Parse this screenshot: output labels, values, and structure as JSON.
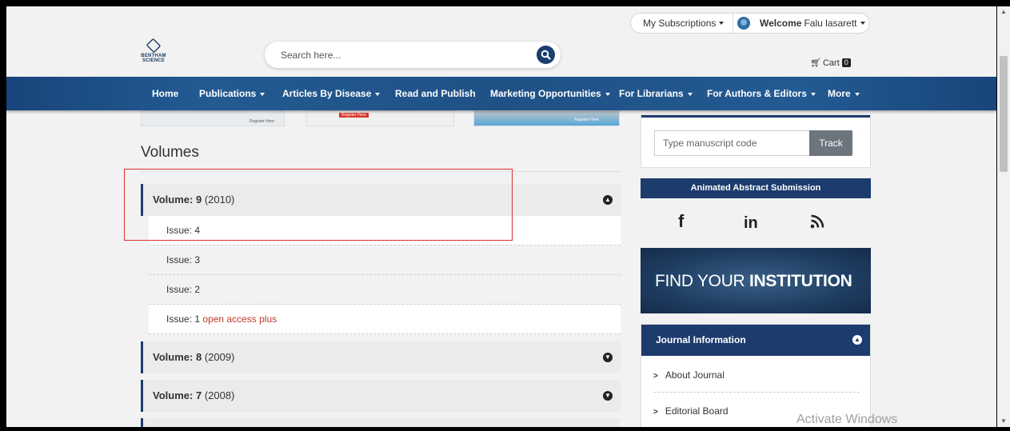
{
  "header": {
    "subscriptions_label": "My Subscriptions",
    "welcome_label": "Welcome",
    "user_name": "Falu lasarett",
    "logo_text_line1": "BENTHAM",
    "logo_text_line2": "SCIENCE",
    "search_placeholder": "Search here...",
    "cart_label": "Cart",
    "cart_count": "0"
  },
  "nav": {
    "items": [
      {
        "label": "Home",
        "dropdown": false
      },
      {
        "label": "Publications",
        "dropdown": true
      },
      {
        "label": "Articles By Disease",
        "dropdown": true
      },
      {
        "label": "Read and Publish",
        "dropdown": false
      },
      {
        "label": "Marketing Opportunities",
        "dropdown": true
      },
      {
        "label": "For Librarians",
        "dropdown": true
      },
      {
        "label": "For Authors & Editors",
        "dropdown": true
      },
      {
        "label": "More",
        "dropdown": true
      }
    ]
  },
  "banners": {
    "banner1_text": "Register Here",
    "banner2_text": "Register Here",
    "banner3_text": "Register Here"
  },
  "main": {
    "title": "Volumes",
    "volumes": [
      {
        "label": "Volume:",
        "number": "9",
        "year": "(2010)",
        "expanded": true,
        "issues": [
          {
            "label": "Issue:",
            "number": "4",
            "badge": ""
          },
          {
            "label": "Issue:",
            "number": "3",
            "badge": ""
          },
          {
            "label": "Issue:",
            "number": "2",
            "badge": ""
          },
          {
            "label": "Issue:",
            "number": "1",
            "badge": "open access plus"
          }
        ]
      },
      {
        "label": "Volume:",
        "number": "8",
        "year": "(2009)",
        "expanded": false
      },
      {
        "label": "Volume:",
        "number": "7",
        "year": "(2008)",
        "expanded": false
      }
    ]
  },
  "sidebar": {
    "track_placeholder": "Type manuscript code",
    "track_button": "Track",
    "animated_abstract_label": "Animated Abstract Submission",
    "social_icons": [
      "facebook-icon",
      "linkedin-icon",
      "rss-icon"
    ],
    "institution_banner_light": "FIND YOUR",
    "institution_banner_bold": "INSTITUTION",
    "journal_info_title": "Journal Information",
    "journal_info_items": [
      "About Journal",
      "Editorial Board"
    ]
  },
  "os_overlay": {
    "activate_windows": "Activate Windows"
  },
  "colors": {
    "brand_navy": "#1d3c6e",
    "highlight_red": "#d9312d",
    "open_access_red": "#c0392b"
  }
}
